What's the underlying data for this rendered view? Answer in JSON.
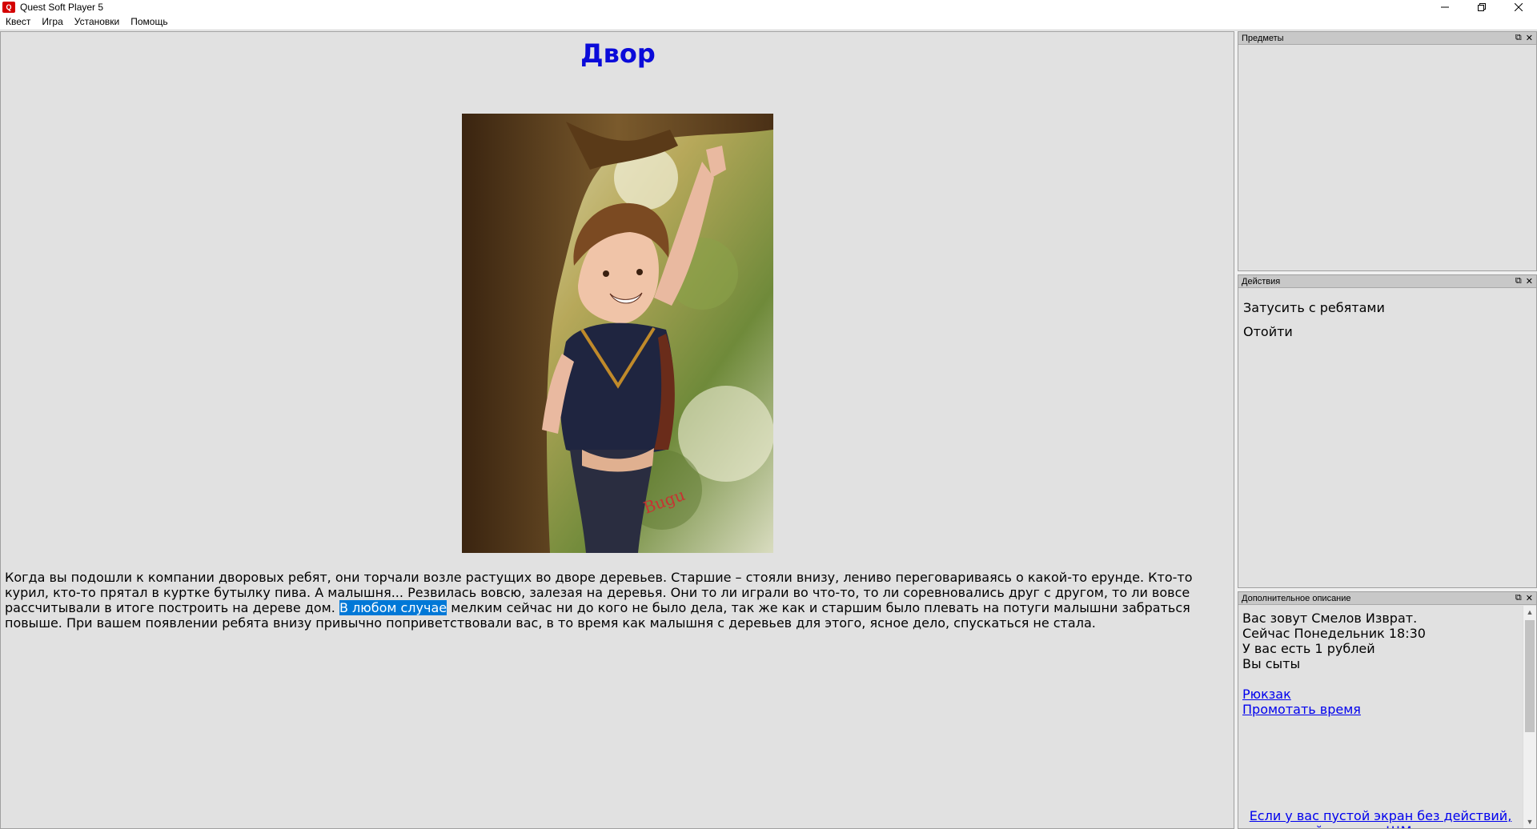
{
  "window": {
    "title": "Quest Soft Player 5",
    "icon_text": "Q"
  },
  "menu": {
    "items": [
      "Квест",
      "Игра",
      "Установки",
      "Помощь"
    ]
  },
  "main": {
    "room_title": "Двор",
    "description_before": "Когда вы подошли к компании дворовых ребят, они торчали возле растущих во дворе деревьев. Старшие – стояли внизу, лениво переговариваясь о какой-то ерунде. Кто-то курил, кто-то прятал в куртке бутылку пива. А малышня... Резвилась вовсю, залезая на деревья. Они то ли играли во что-то, то ли соревновались друг с другом, то ли вовсе рассчитывали в итоге построить на дереве дом.",
    "description_highlight": "В любом случае",
    "description_after": "мелким сейчас ни до кого не было дела, так же как и старшим было плевать на потуги малышни забраться повыше. При вашем появлении ребята внизу привычно поприветствовали вас, в то время как малышня с деревьев для этого, ясное дело, спускаться не стала."
  },
  "panels": {
    "items": {
      "title": "Предметы"
    },
    "actions": {
      "title": "Действия",
      "list": [
        "Затусить с ребятами",
        "Отойти"
      ]
    },
    "extra": {
      "title": "Дополнительное описание",
      "lines": [
        "Вас зовут Смелов Изврат.",
        "Сейчас Понедельник 18:30",
        "У вас есть 1 рублей",
        "Вы сыты"
      ],
      "links": [
        "Рюкзак",
        "Промотать время"
      ],
      "notice": "Если у вас пустой экран без действий, то кликайте сюда. !!!Может вызвать различные баги!!!"
    }
  },
  "colors": {
    "title_blue": "#0b0bd9",
    "highlight": "#0078d7",
    "link": "#0000ee"
  }
}
